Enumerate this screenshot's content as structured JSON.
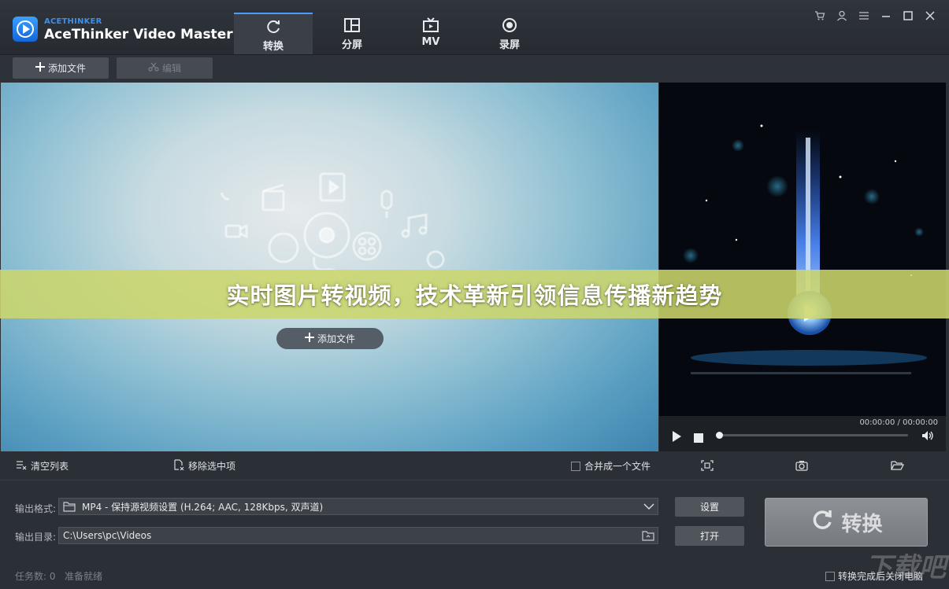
{
  "app": {
    "brand_small": "ACETHINKER",
    "brand_name": "AceThinker Video Master"
  },
  "mode_tabs": [
    {
      "label": "转换",
      "icon": "refresh-icon",
      "active": true
    },
    {
      "label": "分屏",
      "icon": "split-screen-icon",
      "active": false
    },
    {
      "label": "MV",
      "icon": "tv-icon",
      "active": false
    },
    {
      "label": "录屏",
      "icon": "record-icon",
      "active": false
    }
  ],
  "window_controls": [
    "cart-icon",
    "user-icon",
    "menu-icon",
    "minimize-icon",
    "maximize-icon",
    "close-icon"
  ],
  "toolbar": {
    "add_file": "添加文件",
    "edit": "编辑"
  },
  "droparea": {
    "add_file": "添加文件"
  },
  "player": {
    "timecode": "00:00:00 / 00:00:00",
    "progress": 0
  },
  "list_actions": {
    "clear_list": "清空列表",
    "remove_selected": "移除选中项",
    "merge_label": "合并成一个文件"
  },
  "output": {
    "format_label": "输出格式:",
    "format_value": "MP4 - 保持源视频设置 (H.264; AAC, 128Kbps, 双声道)",
    "dir_label": "输出目录:",
    "dir_value": "C:\\Users\\pc\\Videos",
    "settings_button": "设置",
    "open_button": "打开",
    "convert_button": "转换"
  },
  "status": {
    "tasks": "任务数: 0",
    "ready": "准备就绪",
    "shutdown_label": "转换完成后关闭电脑"
  },
  "banner": {
    "text": "实时图片转视频，技术革新引领信息传播新趋势"
  },
  "watermark": "下载吧",
  "colors": {
    "accent": "#4a9dff",
    "banner": "#ccd66c",
    "background": "#2b2f36"
  }
}
